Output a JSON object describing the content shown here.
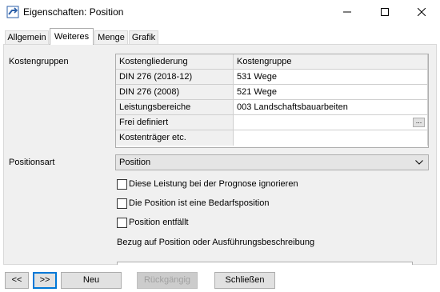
{
  "window": {
    "title": "Eigenschaften: Position",
    "minimize_icon": "minimize-icon",
    "maximize_icon": "maximize-icon",
    "close_icon": "close-icon"
  },
  "tabs": [
    {
      "label": "Allgemein",
      "active": false
    },
    {
      "label": "Weiteres",
      "active": true
    },
    {
      "label": "Menge",
      "active": false
    },
    {
      "label": "Grafik",
      "active": false
    }
  ],
  "kostengruppen": {
    "label": "Kostengruppen",
    "headers": [
      "Kostengliederung",
      "Kostengruppe"
    ],
    "rows": [
      {
        "key": "DIN 276 (2018-12)",
        "value": "531 Wege"
      },
      {
        "key": "DIN 276 (2008)",
        "value": "521 Wege"
      },
      {
        "key": "Leistungsbereiche",
        "value": "003 Landschaftsbauarbeiten"
      },
      {
        "key": "Frei definiert",
        "value": "",
        "ellipsis": "..."
      },
      {
        "key": "Kostenträger etc.",
        "value": ""
      }
    ]
  },
  "positionsart": {
    "label": "Positionsart",
    "value": "Position"
  },
  "checkboxes": [
    {
      "label": "Diese Leistung bei der Prognose ignorieren",
      "checked": false
    },
    {
      "label": "Die Position ist eine Bedarfsposition",
      "checked": false
    },
    {
      "label": "Position entfällt",
      "checked": false
    }
  ],
  "bezug_label": "Bezug auf Position oder Ausführungsbeschreibung",
  "buttons": {
    "prev": "<<",
    "next": ">>",
    "neu": "Neu",
    "rueckgaengig": "Rückgängig",
    "schliessen": "Schließen"
  }
}
